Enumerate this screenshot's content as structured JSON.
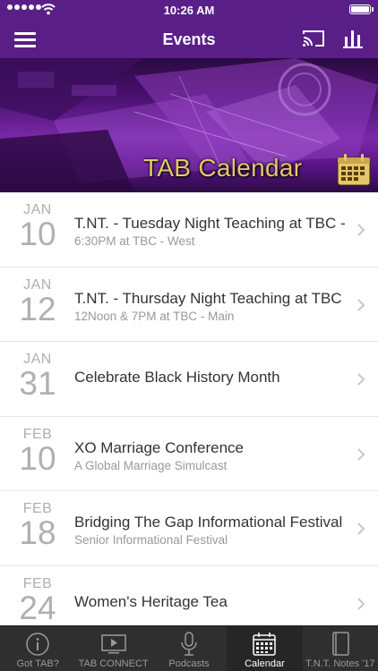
{
  "status_bar": {
    "time": "10:26 AM"
  },
  "nav": {
    "title": "Events"
  },
  "banner": {
    "text": "TAB Calendar"
  },
  "events": [
    {
      "month": "JAN",
      "day": "10",
      "name": "T.NT. - Tuesday Night Teaching at TBC - West",
      "sub": "6:30PM at TBC - West"
    },
    {
      "month": "JAN",
      "day": "12",
      "name": "T.NT. - Thursday Night Teaching at TBC - Main",
      "sub": "12Noon & 7PM at TBC - Main"
    },
    {
      "month": "JAN",
      "day": "31",
      "name": "Celebrate Black History Month",
      "sub": ""
    },
    {
      "month": "FEB",
      "day": "10",
      "name": "XO Marriage Conference",
      "sub": "A Global Marriage Simulcast"
    },
    {
      "month": "FEB",
      "day": "18",
      "name": "Bridging The Gap Informational Festival",
      "sub": "Senior Informational Festival"
    },
    {
      "month": "FEB",
      "day": "24",
      "name": "Women's Heritage Tea",
      "sub": ""
    }
  ],
  "tabs": [
    {
      "label": "Got TAB?",
      "icon": "info-icon",
      "active": false
    },
    {
      "label": "TAB CONNECT",
      "icon": "video-icon",
      "active": false
    },
    {
      "label": "Podcasts",
      "icon": "microphone-icon",
      "active": false
    },
    {
      "label": "Calendar",
      "icon": "calendar-icon",
      "active": true
    },
    {
      "label": "T.N.T. Notes '17",
      "icon": "notebook-icon",
      "active": false
    }
  ],
  "colors": {
    "brand": "#5a1f87",
    "banner_text": "#e4c76a",
    "tab_bar": "#2f2f2f"
  }
}
